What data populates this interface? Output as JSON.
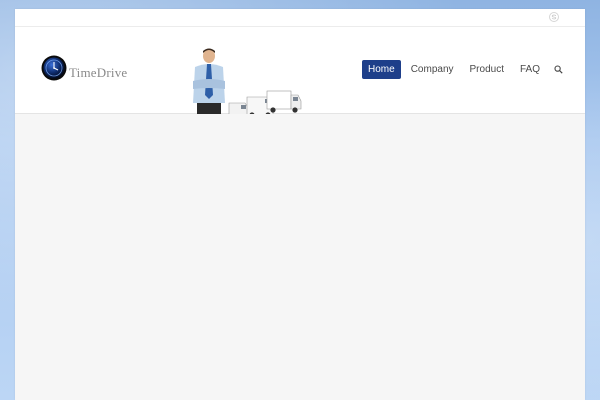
{
  "brand": {
    "logo_text": "TimeDrive"
  },
  "nav": {
    "items": [
      {
        "label": "Home",
        "active": true
      },
      {
        "label": "Company",
        "active": false
      },
      {
        "label": "Product",
        "active": false
      },
      {
        "label": "FAQ",
        "active": false
      }
    ],
    "search_icon": "search-icon"
  },
  "topbar": {
    "social_icon": "skype-icon"
  },
  "colors": {
    "accent": "#1e3f8a",
    "page_background": "#f6f6f6",
    "outer_background": "#a9c8ef"
  }
}
